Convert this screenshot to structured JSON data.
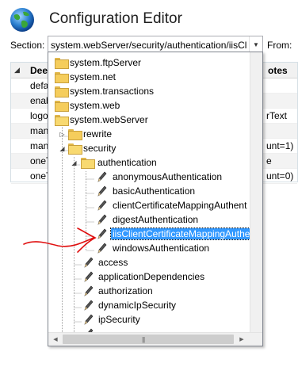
{
  "window": {
    "title": "Configuration Editor"
  },
  "section": {
    "label": "Section:",
    "value": "system.webServer/security/authentication/iisCl",
    "from_label": "From:"
  },
  "grid": {
    "header": {
      "col1": "Dee",
      "col2": "otes"
    },
    "rows": [
      {
        "c1": "defa",
        "c2": ""
      },
      {
        "c1": "enab",
        "c2": ""
      },
      {
        "c1": "logo",
        "c2": "rText"
      },
      {
        "c1": "man",
        "c2": ""
      },
      {
        "c1": "man",
        "c2": "unt=1)"
      },
      {
        "c1": "oneT",
        "c2": "e"
      },
      {
        "c1": "oneT",
        "c2": "unt=0)"
      }
    ]
  },
  "tree": {
    "items": [
      {
        "label": "system.ftpServer",
        "type": "folder",
        "level": 0
      },
      {
        "label": "system.net",
        "type": "folder",
        "level": 0
      },
      {
        "label": "system.transactions",
        "type": "folder",
        "level": 0
      },
      {
        "label": "system.web",
        "type": "folder",
        "level": 0
      },
      {
        "label": "system.webServer",
        "type": "folder-open",
        "level": 0
      },
      {
        "label": "rewrite",
        "type": "folder",
        "level": 1,
        "expander": "+"
      },
      {
        "label": "security",
        "type": "folder-open",
        "level": 1,
        "expander": "-"
      },
      {
        "label": "authentication",
        "type": "folder-open",
        "level": 2,
        "expander": "-"
      },
      {
        "label": "anonymousAuthentication",
        "type": "section",
        "level": 3
      },
      {
        "label": "basicAuthentication",
        "type": "section",
        "level": 3
      },
      {
        "label": "clientCertificateMappingAuthent",
        "type": "section",
        "level": 3
      },
      {
        "label": "digestAuthentication",
        "type": "section",
        "level": 3
      },
      {
        "label": "iisClientCertificateMappingAuthe",
        "type": "section",
        "level": 3,
        "selected": true
      },
      {
        "label": "windowsAuthentication",
        "type": "section",
        "level": 3
      },
      {
        "label": "access",
        "type": "section",
        "level": 2
      },
      {
        "label": "applicationDependencies",
        "type": "section",
        "level": 2
      },
      {
        "label": "authorization",
        "type": "section",
        "level": 2
      },
      {
        "label": "dynamicIpSecurity",
        "type": "section",
        "level": 2
      },
      {
        "label": "ipSecurity",
        "type": "section",
        "level": 2
      },
      {
        "label": "",
        "type": "section",
        "level": 2,
        "partial": true
      }
    ]
  },
  "colors": {
    "selection": "#3399ff",
    "annotation": "#e01010",
    "folder": "#f5cd5c"
  },
  "icons": {
    "app": "globe-icon",
    "section": "pencil-icon",
    "folder": "folder-icon"
  }
}
